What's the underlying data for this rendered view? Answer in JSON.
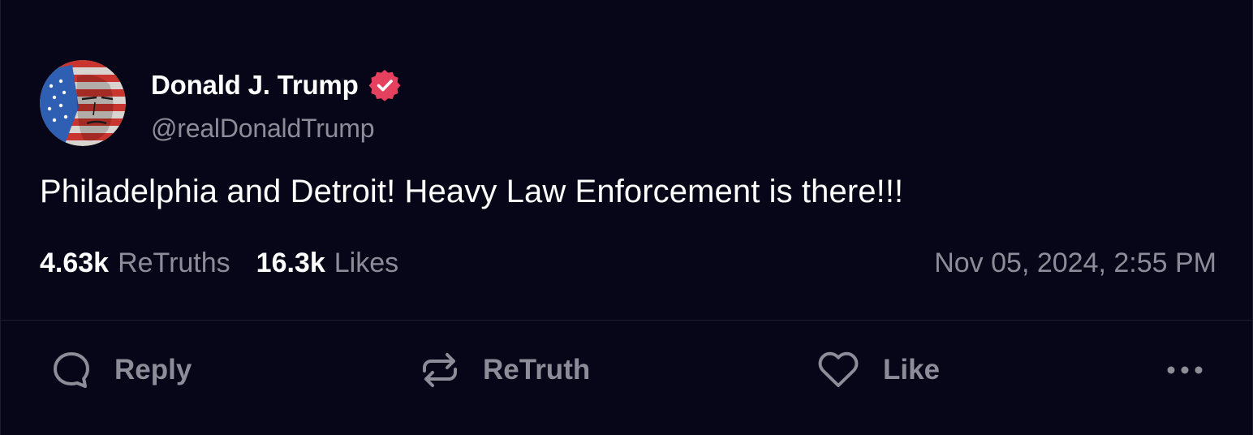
{
  "post": {
    "author": {
      "display_name": "Donald J. Trump",
      "handle": "@realDonaldTrump",
      "verified": true,
      "verified_badge_color": "#e6405f",
      "avatar_description": "flag-painted-portrait"
    },
    "text": "Philadelphia and Detroit! Heavy Law Enforcement is there!!!",
    "stats": {
      "retruths_count": "4.63k",
      "retruths_label": "ReTruths",
      "likes_count": "16.3k",
      "likes_label": "Likes"
    },
    "timestamp": "Nov 05, 2024, 2:55 PM"
  },
  "actions": {
    "reply_label": "Reply",
    "reply_icon": "speech-bubble-icon",
    "retruth_label": "ReTruth",
    "retruth_icon": "repost-arrows-icon",
    "like_label": "Like",
    "like_icon": "heart-icon",
    "more_icon": "ellipsis-icon"
  },
  "colors": {
    "background": "#070618",
    "text_primary": "#ffffff",
    "text_muted": "#8d8c99",
    "divider": "#1c1b2c"
  }
}
